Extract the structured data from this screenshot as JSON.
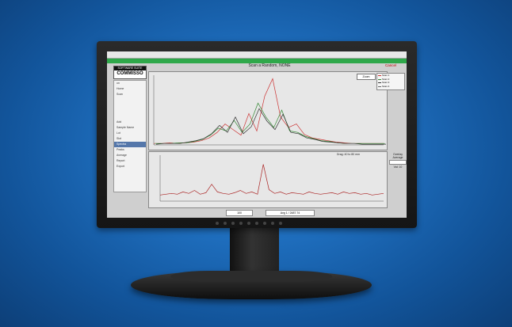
{
  "app": {
    "title": "Scan a Random, NONE",
    "cancel_label": "Cancel"
  },
  "logo": {
    "top_text": "SOFTWARE SUITE",
    "main_text": "COMMISSO"
  },
  "left_panel": {
    "items": [
      {
        "label": "on",
        "selected": false
      },
      {
        "label": "Home",
        "selected": false
      },
      {
        "label": "Scan",
        "selected": false
      },
      {
        "label": "",
        "selected": false
      },
      {
        "label": "",
        "selected": false
      },
      {
        "label": "",
        "selected": false
      },
      {
        "label": "",
        "selected": false
      },
      {
        "label": "Add",
        "selected": false
      },
      {
        "label": "Sample Name",
        "selected": false
      },
      {
        "label": "Lot",
        "selected": false
      },
      {
        "label": "Slot",
        "selected": false
      },
      {
        "label": "Spectra",
        "selected": true
      },
      {
        "label": "Peaks",
        "selected": false
      },
      {
        "label": "Average",
        "selected": false
      },
      {
        "label": "Report",
        "selected": false
      },
      {
        "label": "Export",
        "selected": false
      }
    ]
  },
  "zoom_button": "Zoom",
  "legend": {
    "entries": [
      {
        "label": "Scan 1",
        "color": "#cc3333"
      },
      {
        "label": "Scan 2",
        "color": "#338833"
      },
      {
        "label": "Scan 3",
        "color": "#333333"
      },
      {
        "label": "Scan 4",
        "color": "#666666"
      }
    ]
  },
  "readout": {
    "text": "Drag: 40 to 80 mm"
  },
  "side_info": {
    "label": "Overlay",
    "mode": "Average",
    "value": "Val: 10"
  },
  "status": {
    "field_a": "100",
    "field_b": "Avg 1 / 2487.74"
  },
  "colors": {
    "accent_green": "#2fa84a",
    "selection": "#5577aa",
    "background_blue": "#1f6fbf"
  },
  "chart_data": [
    {
      "type": "line",
      "series": [
        {
          "name": "",
          "color": "#cc3333",
          "values": [
            2,
            2,
            3,
            2,
            3,
            4,
            6,
            10,
            18,
            30,
            22,
            14,
            45,
            20,
            70,
            95,
            40,
            25,
            30,
            15,
            10,
            8,
            6,
            4,
            3,
            2,
            2,
            2,
            2,
            2
          ]
        },
        {
          "name": "",
          "color": "#338833",
          "values": [
            2,
            2,
            2,
            3,
            3,
            5,
            8,
            14,
            24,
            20,
            35,
            18,
            30,
            60,
            40,
            25,
            50,
            20,
            18,
            12,
            9,
            6,
            5,
            3,
            2,
            2,
            2,
            2,
            2,
            2
          ]
        },
        {
          "name": "",
          "color": "#333333",
          "values": [
            1,
            2,
            2,
            2,
            4,
            6,
            9,
            16,
            28,
            18,
            40,
            16,
            26,
            52,
            34,
            22,
            44,
            18,
            16,
            10,
            8,
            5,
            4,
            3,
            2,
            2,
            1,
            1,
            1,
            1
          ]
        }
      ],
      "ylim": [
        0,
        100
      ]
    },
    {
      "type": "line",
      "series": [
        {
          "name": "",
          "color": "#aa2222",
          "values": [
            8,
            9,
            10,
            9,
            12,
            10,
            14,
            9,
            11,
            22,
            12,
            10,
            9,
            11,
            14,
            10,
            12,
            9,
            48,
            15,
            10,
            12,
            9,
            11,
            10,
            9,
            12,
            10,
            9,
            10,
            11,
            9,
            12,
            10,
            11,
            9,
            10,
            8,
            9,
            10
          ]
        }
      ],
      "ylim": [
        0,
        60
      ]
    }
  ]
}
